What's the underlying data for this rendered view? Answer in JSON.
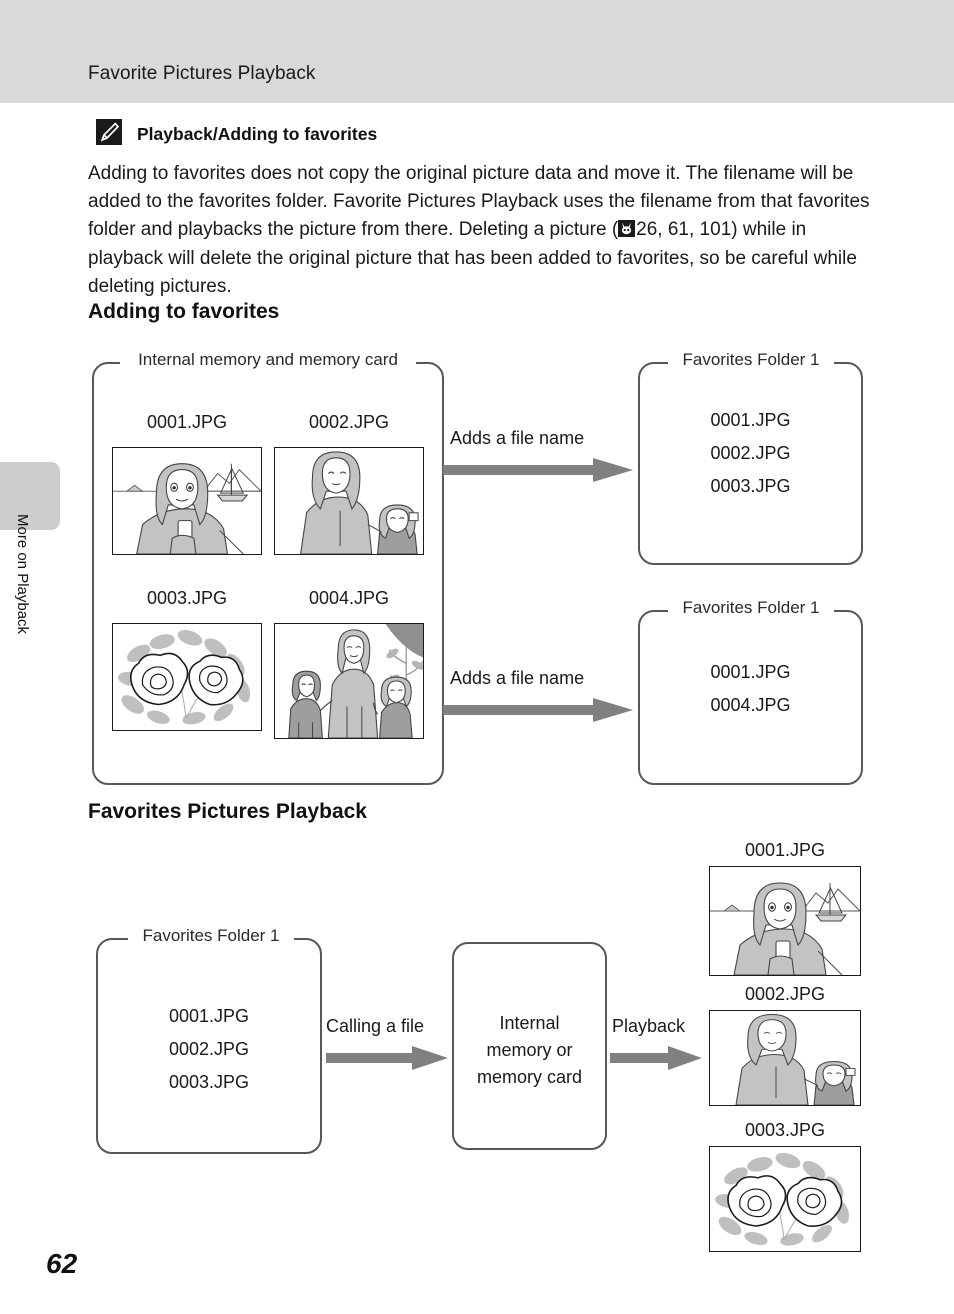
{
  "header": {
    "title": "Favorite Pictures Playback"
  },
  "sidebar": {
    "tab_label": "More on Playback"
  },
  "note": {
    "icon": "pencil-note-icon",
    "heading": "Playback/Adding to favorites",
    "text_part1": "Adding to favorites does not copy the original picture data and move it. The filename will be added to the favorites folder. Favorite Pictures Playback uses the filename from that favorites folder and playbacks the picture from there. Deleting a picture (",
    "page_ref_icon": "see-page-icon",
    "text_part2": "26, 61, 101) while in playback will delete the original picture that has been added to favorites, so be careful while deleting pictures."
  },
  "sections": {
    "adding": {
      "heading": "Adding to favorites",
      "source_box": {
        "caption": "Internal memory and memory card",
        "thumbs": [
          {
            "caption": "0001.JPG",
            "art": "woman-seascape"
          },
          {
            "caption": "0002.JPG",
            "art": "woman-child"
          },
          {
            "caption": "0003.JPG",
            "art": "flowers"
          },
          {
            "caption": "0004.JPG",
            "art": "family-group"
          }
        ]
      },
      "arrows": [
        {
          "label": "Adds a file name"
        },
        {
          "label": "Adds a file name"
        }
      ],
      "folders": [
        {
          "caption": "Favorites Folder 1",
          "files": [
            "0001.JPG",
            "0002.JPG",
            "0003.JPG"
          ]
        },
        {
          "caption": "Favorites Folder 1",
          "files": [
            "0001.JPG",
            "0004.JPG"
          ]
        }
      ]
    },
    "playback": {
      "heading": "Favorites Pictures Playback",
      "folder": {
        "caption": "Favorites Folder 1",
        "files": [
          "0001.JPG",
          "0002.JPG",
          "0003.JPG"
        ]
      },
      "arrow1_label": "Calling a file",
      "memory_box": {
        "text": "Internal\nmemory or\nmemory card",
        "line1": "Internal",
        "line2": "memory or",
        "line3": "memory card"
      },
      "arrow2_label": "Playback",
      "thumbs": [
        {
          "caption": "0001.JPG",
          "art": "woman-seascape"
        },
        {
          "caption": "0002.JPG",
          "art": "woman-child"
        },
        {
          "caption": "0003.JPG",
          "art": "flowers"
        }
      ]
    }
  },
  "footer": {
    "page_number": "62"
  },
  "colors": {
    "header_band": "#d9d9d9",
    "tab": "#cdcdcd",
    "box_border": "#575757",
    "arrow": "#808080",
    "text": "#1a1a1a"
  }
}
